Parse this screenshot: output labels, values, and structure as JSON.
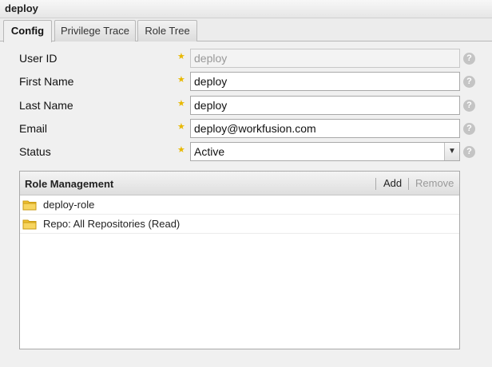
{
  "panel": {
    "title": "deploy"
  },
  "tabs": [
    {
      "label": "Config",
      "active": true
    },
    {
      "label": "Privilege Trace",
      "active": false
    },
    {
      "label": "Role Tree",
      "active": false
    }
  ],
  "form": {
    "user_id": {
      "label": "User ID",
      "value": "deploy"
    },
    "first_name": {
      "label": "First Name",
      "value": "deploy"
    },
    "last_name": {
      "label": "Last Name",
      "value": "deploy"
    },
    "email": {
      "label": "Email",
      "value": "deploy@workfusion.com"
    },
    "status": {
      "label": "Status",
      "value": "Active"
    },
    "help_glyph": "?",
    "required_glyph": "★"
  },
  "roles": {
    "title": "Role Management",
    "add_label": "Add",
    "remove_label": "Remove",
    "items": [
      {
        "label": "deploy-role",
        "icon": "folder-icon"
      },
      {
        "label": "Repo: All Repositories (Read)",
        "icon": "folder-icon"
      }
    ]
  },
  "colors": {
    "star": "#e8b800",
    "folder": "#f1c232",
    "disabled_text": "#999999"
  }
}
